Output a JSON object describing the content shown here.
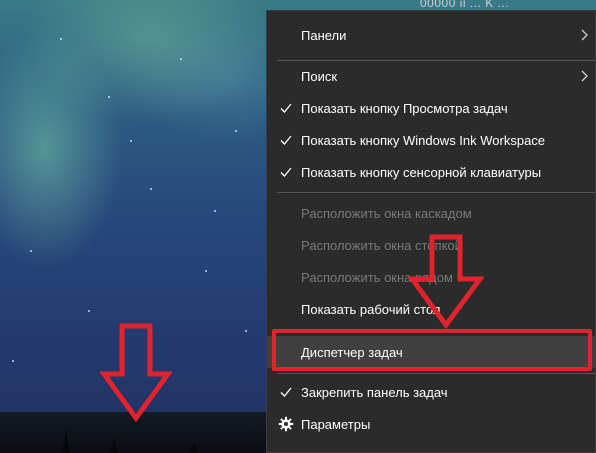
{
  "topbar": {
    "text": "00000 ii ... K ..."
  },
  "menu": {
    "items": [
      {
        "label": "Панели",
        "checked": false,
        "disabled": false,
        "submenu": true
      },
      {
        "label": "Поиск",
        "checked": false,
        "disabled": false,
        "submenu": true
      },
      {
        "label": "Показать кнопку Просмотра задач",
        "checked": true,
        "disabled": false,
        "submenu": false
      },
      {
        "label": "Показать кнопку Windows Ink Workspace",
        "checked": true,
        "disabled": false,
        "submenu": false
      },
      {
        "label": "Показать кнопку сенсорной клавиатуры",
        "checked": true,
        "disabled": false,
        "submenu": false
      },
      {
        "label": "Расположить окна каскадом",
        "checked": false,
        "disabled": true,
        "submenu": false
      },
      {
        "label": "Расположить окна стопкой",
        "checked": false,
        "disabled": true,
        "submenu": false
      },
      {
        "label": "Расположить окна рядом",
        "checked": false,
        "disabled": true,
        "submenu": false
      },
      {
        "label": "Показать рабочий стол",
        "checked": false,
        "disabled": false,
        "submenu": false
      },
      {
        "label": "Диспетчер задач",
        "checked": false,
        "disabled": false,
        "submenu": false,
        "highlighted": true
      },
      {
        "label": "Закрепить панель задач",
        "checked": true,
        "disabled": false,
        "submenu": false
      },
      {
        "label": "Параметры",
        "checked": false,
        "disabled": false,
        "submenu": false,
        "icon": "gear-icon"
      }
    ]
  },
  "colors": {
    "accent_red": "#e0232d",
    "menu_bg": "#2b2b2b",
    "disabled_text": "#7a7a7a"
  }
}
